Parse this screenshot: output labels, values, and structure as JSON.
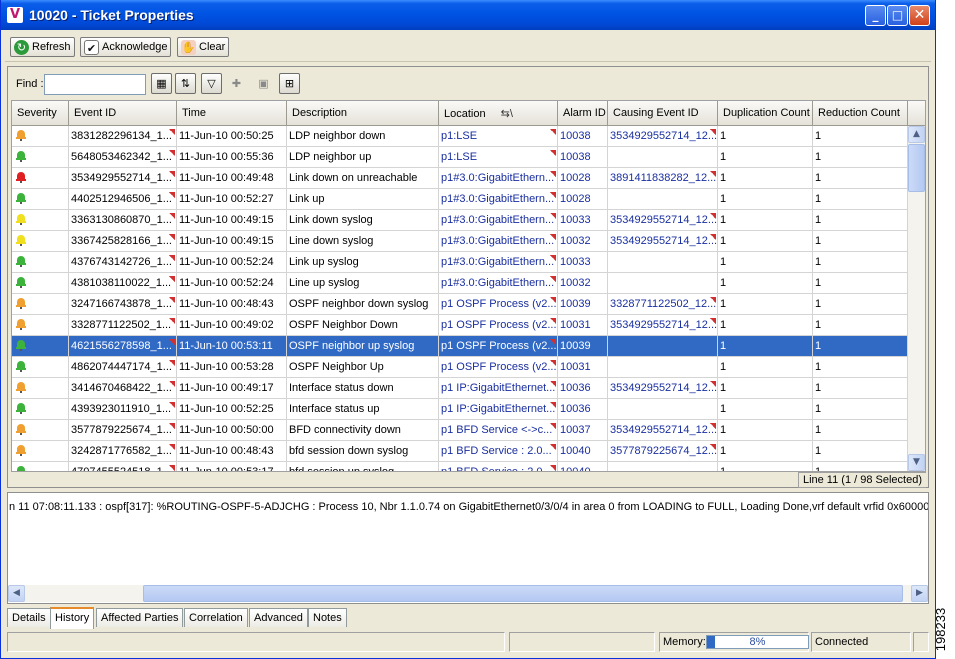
{
  "window": {
    "title": "10020 - Ticket Properties",
    "icon_letter": "V"
  },
  "toolbar": {
    "refresh_label": "Refresh",
    "acknowledge_label": "Acknowledge",
    "clear_label": "Clear"
  },
  "find": {
    "label": "Find :",
    "value": ""
  },
  "columns": [
    {
      "key": "severity",
      "label": "Severity",
      "w": 57
    },
    {
      "key": "event_id",
      "label": "Event ID",
      "w": 108
    },
    {
      "key": "time",
      "label": "Time",
      "w": 110
    },
    {
      "key": "description",
      "label": "Description",
      "w": 152
    },
    {
      "key": "location",
      "label": "Location",
      "w": 119
    },
    {
      "key": "alarm_id",
      "label": "Alarm ID",
      "w": 50
    },
    {
      "key": "causing_event_id",
      "label": "Causing Event ID",
      "w": 110
    },
    {
      "key": "duplication_count",
      "label": "Duplication Count",
      "w": 95
    },
    {
      "key": "reduction_count",
      "label": "Reduction Count",
      "w": 95
    }
  ],
  "severity_colors": {
    "minor": "#f0a030",
    "cleared": "#3cb43c",
    "critical": "#e02020",
    "warning": "#f0e020"
  },
  "rows": [
    {
      "sev": "minor",
      "event_id": "3831282296134_1...",
      "time": "11-Jun-10 00:50:25",
      "description": "LDP neighbor down",
      "location": "p1:LSE",
      "alarm_id": "10038",
      "causing": "3534929552714_12...",
      "dup": "1",
      "red": "1"
    },
    {
      "sev": "cleared",
      "event_id": "5648053462342_1...",
      "time": "11-Jun-10 00:55:36",
      "description": "LDP neighbor up",
      "location": "p1:LSE",
      "alarm_id": "10038",
      "causing": "",
      "dup": "1",
      "red": "1"
    },
    {
      "sev": "critical",
      "event_id": "3534929552714_1...",
      "time": "11-Jun-10 00:49:48",
      "description": "Link down on unreachable",
      "location": "p1#3.0:GigabitEthern...",
      "alarm_id": "10028",
      "causing": "3891411838282_12...",
      "dup": "1",
      "red": "1"
    },
    {
      "sev": "cleared",
      "event_id": "4402512946506_1...",
      "time": "11-Jun-10 00:52:27",
      "description": "Link up",
      "location": "p1#3.0:GigabitEthern...",
      "alarm_id": "10028",
      "causing": "",
      "dup": "1",
      "red": "1"
    },
    {
      "sev": "warning",
      "event_id": "3363130860870_1...",
      "time": "11-Jun-10 00:49:15",
      "description": "Link down syslog",
      "location": "p1#3.0:GigabitEthern...",
      "alarm_id": "10033",
      "causing": "3534929552714_12...",
      "dup": "1",
      "red": "1"
    },
    {
      "sev": "warning",
      "event_id": "3367425828166_1...",
      "time": "11-Jun-10 00:49:15",
      "description": "Line down syslog",
      "location": "p1#3.0:GigabitEthern...",
      "alarm_id": "10032",
      "causing": "3534929552714_12...",
      "dup": "1",
      "red": "1"
    },
    {
      "sev": "cleared",
      "event_id": "4376743142726_1...",
      "time": "11-Jun-10 00:52:24",
      "description": "Link up syslog",
      "location": "p1#3.0:GigabitEthern...",
      "alarm_id": "10033",
      "causing": "",
      "dup": "1",
      "red": "1"
    },
    {
      "sev": "cleared",
      "event_id": "4381038110022_1...",
      "time": "11-Jun-10 00:52:24",
      "description": "Line up syslog",
      "location": "p1#3.0:GigabitEthern...",
      "alarm_id": "10032",
      "causing": "",
      "dup": "1",
      "red": "1"
    },
    {
      "sev": "minor",
      "event_id": "3247166743878_1...",
      "time": "11-Jun-10 00:48:43",
      "description": "OSPF neighbor down syslog",
      "location": "p1 OSPF Process (v2...",
      "alarm_id": "10039",
      "causing": "3328771122502_12...",
      "dup": "1",
      "red": "1"
    },
    {
      "sev": "minor",
      "event_id": "3328771122502_1...",
      "time": "11-Jun-10 00:49:02",
      "description": "OSPF Neighbor Down",
      "location": "p1 OSPF Process (v2...",
      "alarm_id": "10031",
      "causing": "3534929552714_12...",
      "dup": "1",
      "red": "1"
    },
    {
      "sev": "cleared",
      "event_id": "4621556278598_1...",
      "time": "11-Jun-10 00:53:11",
      "description": "OSPF neighbor up syslog",
      "location": "p1 OSPF Process (v2...",
      "alarm_id": "10039",
      "causing": "",
      "dup": "1",
      "red": "1",
      "selected": true
    },
    {
      "sev": "cleared",
      "event_id": "4862074447174_1...",
      "time": "11-Jun-10 00:53:28",
      "description": "OSPF Neighbor Up",
      "location": "p1 OSPF Process (v2...",
      "alarm_id": "10031",
      "causing": "",
      "dup": "1",
      "red": "1"
    },
    {
      "sev": "minor",
      "event_id": "3414670468422_1...",
      "time": "11-Jun-10 00:49:17",
      "description": "Interface status down",
      "location": "p1 IP:GigabitEthernet...",
      "alarm_id": "10036",
      "causing": "3534929552714_12...",
      "dup": "1",
      "red": "1"
    },
    {
      "sev": "cleared",
      "event_id": "4393923011910_1...",
      "time": "11-Jun-10 00:52:25",
      "description": "Interface status up",
      "location": "p1 IP:GigabitEthernet...",
      "alarm_id": "10036",
      "causing": "",
      "dup": "1",
      "red": "1"
    },
    {
      "sev": "minor",
      "event_id": "3577879225674_1...",
      "time": "11-Jun-10 00:50:00",
      "description": "BFD connectivity down",
      "location": "p1 BFD Service <->c...",
      "alarm_id": "10037",
      "causing": "3534929552714_12...",
      "dup": "1",
      "red": "1"
    },
    {
      "sev": "minor",
      "event_id": "3242871776582_1...",
      "time": "11-Jun-10 00:48:43",
      "description": "bfd session down syslog",
      "location": "p1 BFD Service : 2.0...",
      "alarm_id": "10040",
      "causing": "3577879225674_12...",
      "dup": "1",
      "red": "1"
    },
    {
      "sev": "cleared",
      "event_id": "4707455524518_1...",
      "time": "11-Jun-10 00:53:17",
      "description": "bfd session up syslog",
      "location": "p1 BFD Service : 2.0...",
      "alarm_id": "10040",
      "causing": "",
      "dup": "1",
      "red": "1"
    }
  ],
  "table_status": "Line 11 (1 / 98 Selected)",
  "detail_text": "n 11 07:08:11.133 : ospf[317]: %ROUTING-OSPF-5-ADJCHG : Process 10, Nbr 1.1.0.74 on GigabitEthernet0/3/0/4 in area 0 from LOADING to FULL, Loading Done,vrf default vrfid 0x60000000",
  "tabs": [
    {
      "label": "Details",
      "active": false
    },
    {
      "label": "History",
      "active": true
    },
    {
      "label": "Affected Parties",
      "active": false
    },
    {
      "label": "Correlation",
      "active": false
    },
    {
      "label": "Advanced",
      "active": false
    },
    {
      "label": "Notes",
      "active": false
    }
  ],
  "statusbar": {
    "memory_label": "Memory:",
    "memory_percent": 8,
    "memory_text": "8%",
    "connection": "Connected"
  },
  "side_label": "198233"
}
